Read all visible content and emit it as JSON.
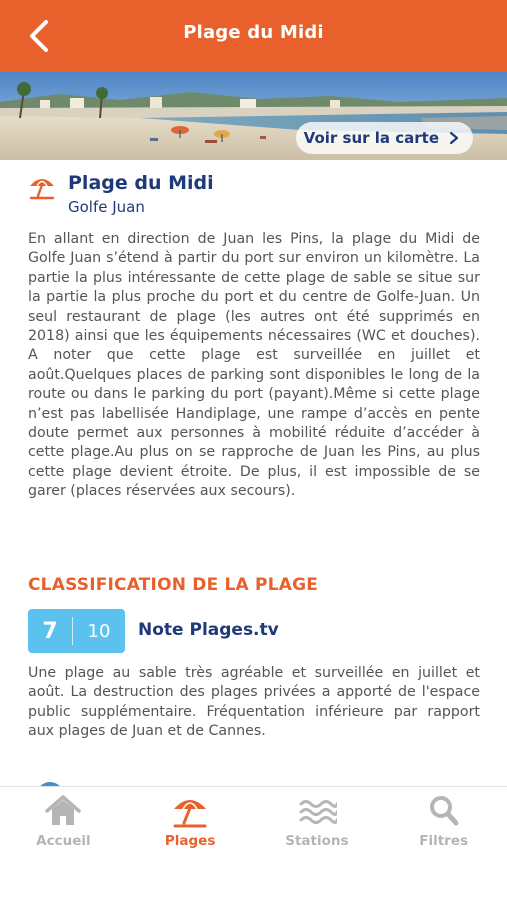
{
  "header": {
    "title": "Plage du Midi",
    "back_icon": "chevron-left-icon"
  },
  "banner": {
    "map_button_label": "Voir sur la carte",
    "map_button_icon": "chevron-right-icon"
  },
  "place": {
    "icon": "beach-umbrella-icon",
    "name": "Plage du Midi",
    "town": "Golfe Juan",
    "description": "En allant en direction de Juan les Pins, la plage du Midi de Golfe Juan s’étend à partir du port sur environ un kilomètre. La partie la plus intéressante de cette plage de sable se situe sur la partie la plus proche du port et du centre de Golfe-Juan. Un seul restaurant de plage (les autres ont été supprimés en 2018) ainsi que les équipements nécessaires (WC et douches). A noter que cette plage est surveillée en juillet et août.Quelques places de parking sont disponibles le long de la route ou dans le parking du port (payant).Même si cette plage n’est pas labellisée Handiplage, une rampe d’accès en pente doute permet aux personnes à mobilité réduite d’accéder à cette plage.Au plus on se rapproche de Juan les Pins, au plus cette plage devient étroite. De plus, il est impossible de se garer (places réservées aux secours)."
  },
  "classification": {
    "section_title": "CLASSIFICATION DE LA PLAGE",
    "score": "7",
    "score_max": "10",
    "source": "Note Plages.tv",
    "review": "Une plage au sable très agréable et surveillée en juillet et août. La destruction des plages privées a apporté de l'espace public supplémentaire. Fréquentation inférieure par rapport aux plages de Juan et de Cannes."
  },
  "tabbar": {
    "tabs": [
      {
        "label": "Accueil",
        "icon": "home-icon",
        "active": false
      },
      {
        "label": "Plages",
        "icon": "beach-umbrella-icon",
        "active": true
      },
      {
        "label": "Stations",
        "icon": "waves-icon",
        "active": false
      },
      {
        "label": "Filtres",
        "icon": "search-icon",
        "active": false
      }
    ]
  },
  "colors": {
    "accent": "#e8612c",
    "title_blue": "#1f3a7a",
    "score_blue": "#5bc2f0",
    "inactive_gray": "#b5b5b5"
  }
}
